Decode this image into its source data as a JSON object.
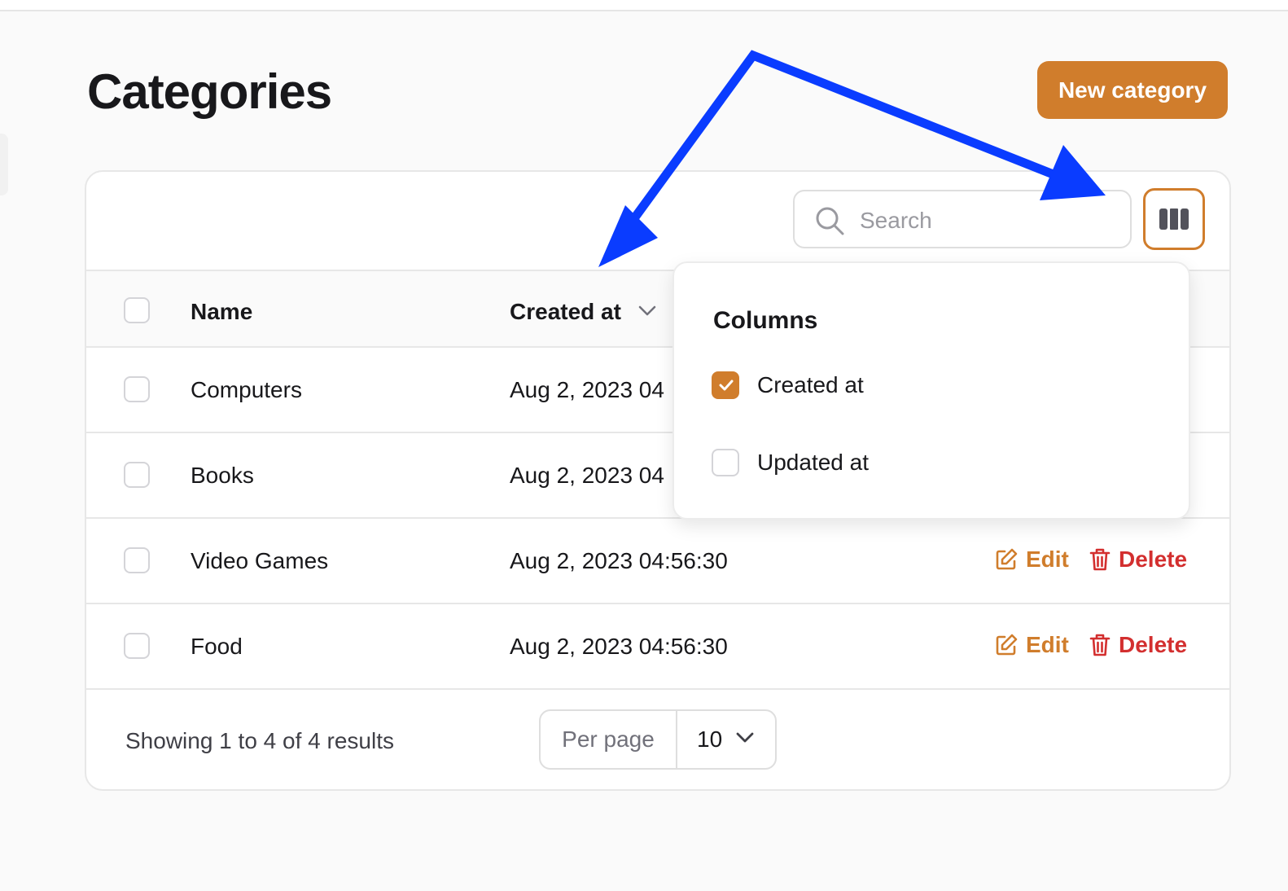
{
  "page": {
    "title": "Categories"
  },
  "actions": {
    "new_label": "New category"
  },
  "toolbar": {
    "search_placeholder": "Search"
  },
  "table": {
    "headers": {
      "name": "Name",
      "created_at": "Created at"
    },
    "rows": [
      {
        "name": "Computers",
        "created_at": "Aug 2, 2023 04"
      },
      {
        "name": "Books",
        "created_at": "Aug 2, 2023 04"
      },
      {
        "name": "Video Games",
        "created_at": "Aug 2, 2023 04:56:30",
        "edit": "Edit",
        "delete": "Delete"
      },
      {
        "name": "Food",
        "created_at": "Aug 2, 2023 04:56:30",
        "edit": "Edit",
        "delete": "Delete"
      }
    ]
  },
  "footer": {
    "summary": "Showing 1 to 4 of 4 results",
    "per_page_label": "Per page",
    "per_page_value": "10"
  },
  "columns_menu": {
    "title": "Columns",
    "options": [
      {
        "label": "Created at",
        "checked": true
      },
      {
        "label": "Updated at",
        "checked": false
      }
    ]
  },
  "colors": {
    "accent": "#d07d2c",
    "danger": "#d32f2f",
    "annotation_arrow": "#0a3cff"
  },
  "icons": [
    "search-icon",
    "columns-icon",
    "chevron-down-icon",
    "edit-icon",
    "trash-icon",
    "check-icon"
  ]
}
